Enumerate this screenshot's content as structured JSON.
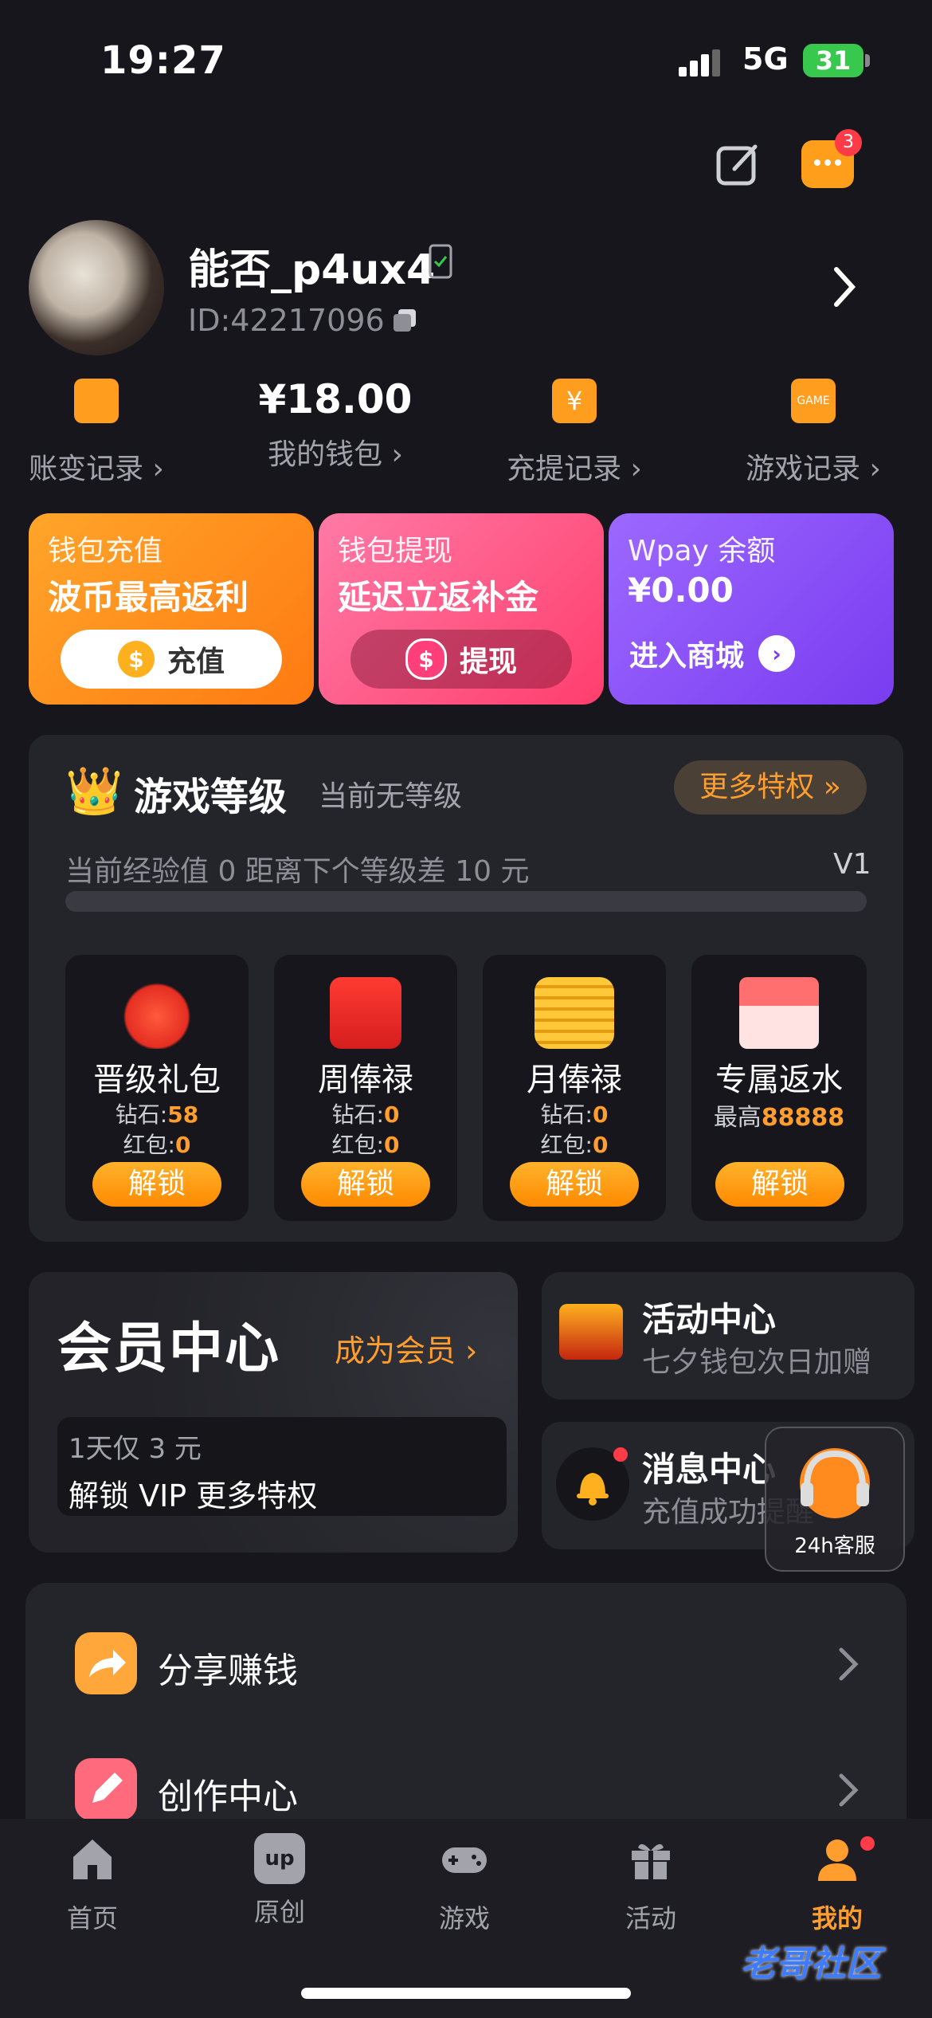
{
  "status": {
    "time": "19:27",
    "network": "5G",
    "battery": "31"
  },
  "header": {
    "chat_badge": "3"
  },
  "profile": {
    "name": "能否_p4ux4",
    "id": "ID:42217096"
  },
  "quick": [
    {
      "label": "账变记录 ›",
      "value": ""
    },
    {
      "label": "我的钱包 ›",
      "value": "¥18.00"
    },
    {
      "label": "充提记录 ›",
      "value": ""
    },
    {
      "label": "游戏记录 ›",
      "value": ""
    }
  ],
  "cards": {
    "recharge": {
      "title": "钱包充值",
      "headline": "波币最高返利",
      "button": "充值"
    },
    "withdraw": {
      "title": "钱包提现",
      "headline": "延迟立返补金",
      "button": "提现"
    },
    "wpay": {
      "title": "Wpay 余额",
      "amount": "¥0.00",
      "button": "进入商城"
    }
  },
  "level": {
    "title": "游戏等级",
    "current": "当前无等级",
    "more": "更多特权 »",
    "exp_text": "当前经验值 0 距离下个等级差 10 元",
    "next_level": "V1",
    "progress": 0,
    "perks": [
      {
        "name": "晋级礼包",
        "line1_label": "钻石:",
        "line1_value": "58",
        "line2_label": "红包:",
        "line2_value": "0",
        "button": "解锁"
      },
      {
        "name": "周俸禄",
        "line1_label": "钻石:",
        "line1_value": "0",
        "line2_label": "红包:",
        "line2_value": "0",
        "button": "解锁"
      },
      {
        "name": "月俸禄",
        "line1_label": "钻石:",
        "line1_value": "0",
        "line2_label": "红包:",
        "line2_value": "0",
        "button": "解锁"
      },
      {
        "name": "专属返水",
        "line1_label": "最高",
        "line1_value": "88888",
        "button": "解锁"
      }
    ]
  },
  "member": {
    "title": "会员中心",
    "become": "成为会员 ›",
    "line1": "1天仅 3 元",
    "line2": "解锁 VIP 更多特权"
  },
  "activity": {
    "title": "活动中心",
    "subtitle": "七夕钱包次日加赠"
  },
  "message": {
    "title": "消息中心",
    "subtitle": "充值成功提醒"
  },
  "support": {
    "label": "24h客服"
  },
  "list": [
    {
      "label": "分享赚钱"
    },
    {
      "label": "创作中心"
    }
  ],
  "nav": [
    {
      "label": "首页"
    },
    {
      "label": "原创"
    },
    {
      "label": "游戏"
    },
    {
      "label": "活动"
    },
    {
      "label": "我的"
    }
  ],
  "watermark": "老哥社区",
  "colors": {
    "accent": "#ff9d2e",
    "background": "#16161c",
    "panel": "#24242b"
  }
}
